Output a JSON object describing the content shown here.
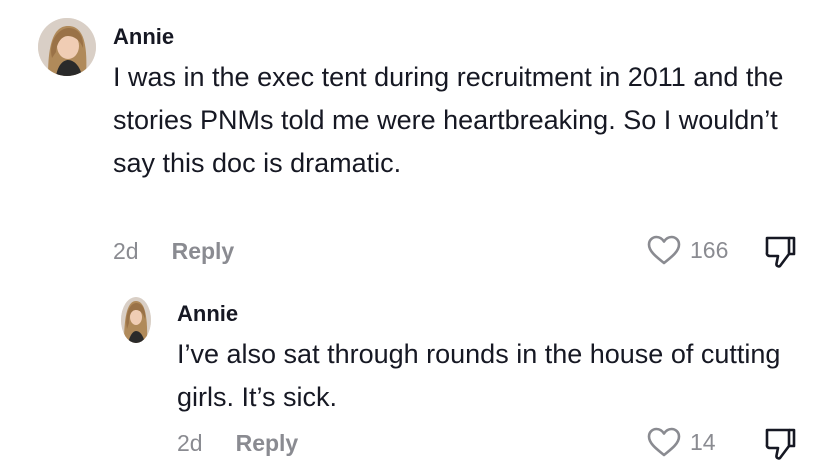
{
  "comments": [
    {
      "username": "Annie",
      "text": "I was in the exec tent during recruitment in 2011 and the stories PNMs told me were heartbreaking. So I wouldn’t say this doc is dramatic.",
      "time": "2d",
      "reply_label": "Reply",
      "like_count": "166",
      "avatar_icon": "profile-photo",
      "like_icon": "heart-outline-icon",
      "dislike_icon": "thumbs-down-icon"
    }
  ],
  "replies": [
    {
      "username": "Annie",
      "text": "I’ve also sat through rounds in the house of cutting girls. It’s sick.",
      "time": "2d",
      "reply_label": "Reply",
      "like_count": "14",
      "avatar_icon": "profile-photo",
      "like_icon": "heart-outline-icon",
      "dislike_icon": "thumbs-down-icon"
    }
  ],
  "colors": {
    "text_primary": "#161823",
    "text_secondary": "#8a8b91",
    "background": "#ffffff"
  }
}
